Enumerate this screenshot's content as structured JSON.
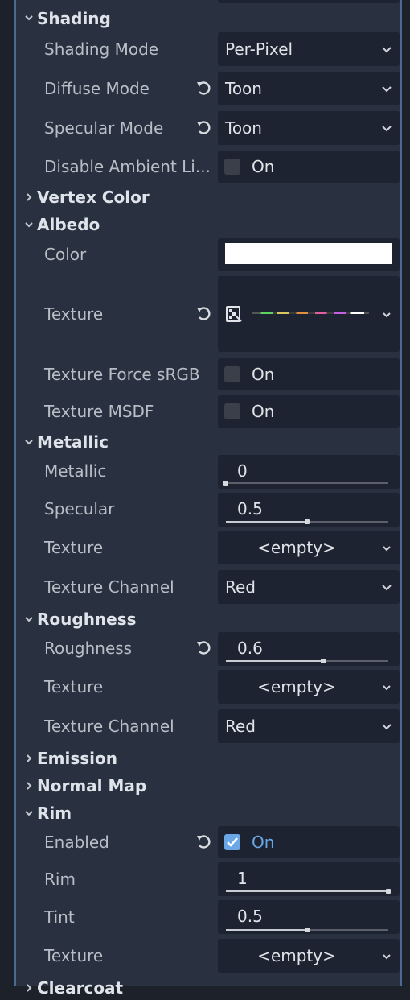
{
  "sections": {
    "shading": {
      "title": "Shading",
      "expanded": true
    },
    "vertex_color": {
      "title": "Vertex Color",
      "expanded": false
    },
    "albedo": {
      "title": "Albedo",
      "expanded": true
    },
    "metallic": {
      "title": "Metallic",
      "expanded": true
    },
    "roughness": {
      "title": "Roughness",
      "expanded": true
    },
    "emission": {
      "title": "Emission",
      "expanded": false
    },
    "normal_map": {
      "title": "Normal Map",
      "expanded": false
    },
    "rim": {
      "title": "Rim",
      "expanded": true
    },
    "clearcoat": {
      "title": "Clearcoat",
      "expanded": false
    }
  },
  "shading": {
    "shading_mode": {
      "label": "Shading Mode",
      "value": "Per-Pixel"
    },
    "diffuse_mode": {
      "label": "Diffuse Mode",
      "value": "Toon"
    },
    "specular_mode": {
      "label": "Specular Mode",
      "value": "Toon"
    },
    "disable_ambient": {
      "label": "Disable Ambient Li...",
      "value": "On",
      "checked": false
    }
  },
  "albedo": {
    "color": {
      "label": "Color",
      "value": "#ffffff"
    },
    "texture": {
      "label": "Texture"
    },
    "force_srgb": {
      "label": "Texture Force sRGB",
      "value": "On",
      "checked": false
    },
    "msdf": {
      "label": "Texture MSDF",
      "value": "On",
      "checked": false
    }
  },
  "metallic": {
    "metallic": {
      "label": "Metallic",
      "value": "0",
      "fraction": 0.0
    },
    "specular": {
      "label": "Specular",
      "value": "0.5",
      "fraction": 0.5
    },
    "texture": {
      "label": "Texture",
      "value": "<empty>"
    },
    "channel": {
      "label": "Texture Channel",
      "value": "Red"
    }
  },
  "roughness": {
    "roughness": {
      "label": "Roughness",
      "value": "0.6",
      "fraction": 0.6
    },
    "texture": {
      "label": "Texture",
      "value": "<empty>"
    },
    "channel": {
      "label": "Texture Channel",
      "value": "Red"
    }
  },
  "rim": {
    "enabled": {
      "label": "Enabled",
      "value": "On",
      "checked": true
    },
    "rim": {
      "label": "Rim",
      "value": "1",
      "fraction": 1.0
    },
    "tint": {
      "label": "Tint",
      "value": "0.5",
      "fraction": 0.5
    },
    "texture": {
      "label": "Texture",
      "value": "<empty>"
    }
  },
  "icons": {
    "revert": "revert-icon",
    "expanded": "chevron-down-icon",
    "collapsed": "chevron-right-icon",
    "dropdown": "chevron-down-icon",
    "texture": "texture-icon"
  },
  "colors": {
    "panel_bg": "#293140",
    "field_bg": "#1d2330",
    "accent": "#6ba7e6",
    "border": "#4d6b92"
  }
}
